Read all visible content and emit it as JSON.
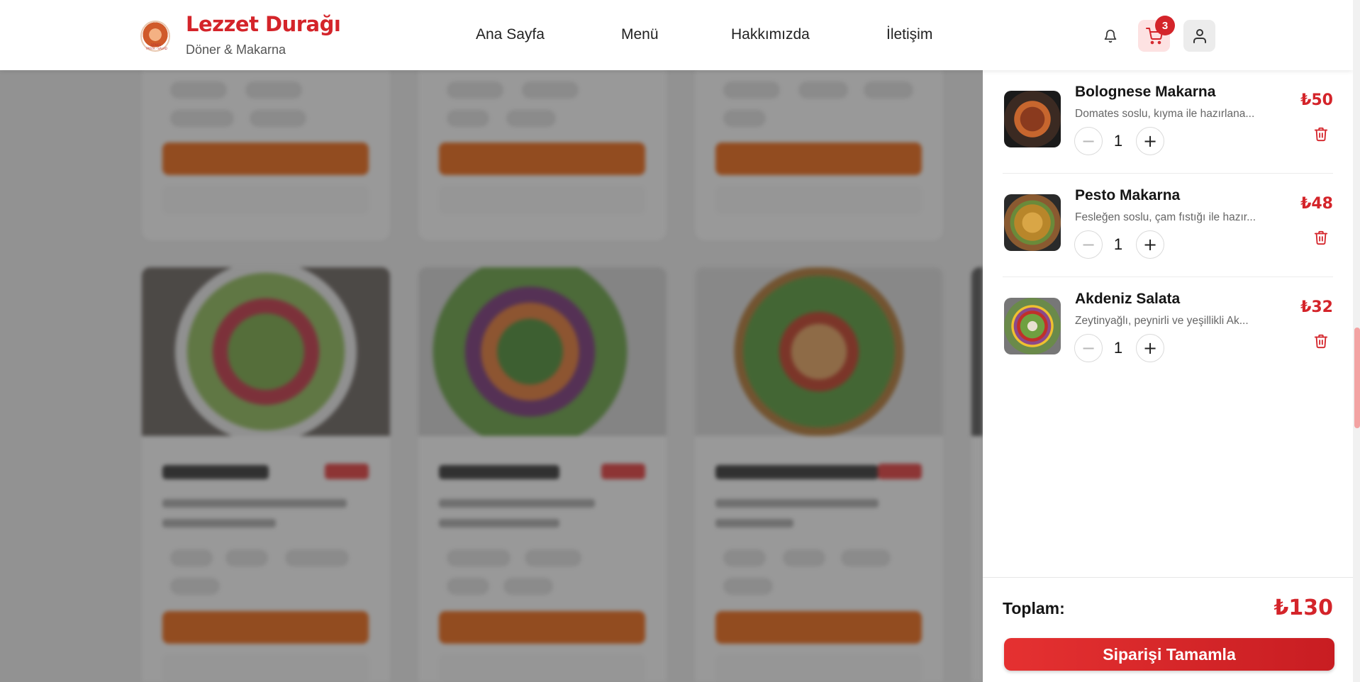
{
  "brand": {
    "title": "Lezzet Durağı",
    "subtitle": "Döner & Makarna",
    "logo_text": "DÖNER · PASTA · SALAD"
  },
  "nav": {
    "items": [
      {
        "label": "Ana Sayfa"
      },
      {
        "label": "Menü"
      },
      {
        "label": "Hakkımızda"
      },
      {
        "label": "İletişim"
      }
    ]
  },
  "header_actions": {
    "bell_icon": "bell-icon",
    "cart_icon": "cart-icon",
    "user_icon": "user-icon",
    "cart_count": "3"
  },
  "cart": {
    "items": [
      {
        "name": "Bolognese Makarna",
        "description": "Domates soslu, kıyma ile hazırlana...",
        "quantity": "1",
        "price": "₺50"
      },
      {
        "name": "Pesto Makarna",
        "description": "Fesleğen soslu, çam fıstığı ile hazır...",
        "quantity": "1",
        "price": "₺48"
      },
      {
        "name": "Akdeniz Salata",
        "description": "Zeytinyağlı, peynirli ve yeşillikli Ak...",
        "quantity": "1",
        "price": "₺32"
      }
    ],
    "minus_symbol": "−",
    "plus_symbol": "+",
    "total_label": "Toplam:",
    "total_value": "₺130",
    "checkout_label": "Siparişi Tamamla"
  },
  "colors": {
    "accent": "#d4242a",
    "cart_button_bg": "#fde2e2",
    "menu_button_orange": "#ea6a1b"
  }
}
